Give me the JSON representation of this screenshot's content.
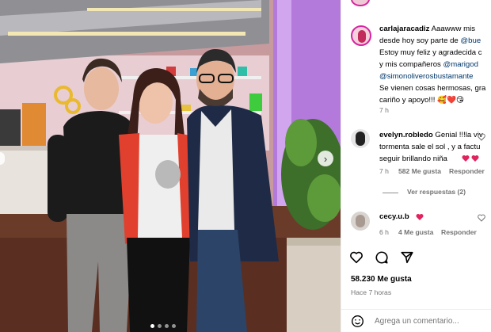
{
  "post": {
    "author": "carlajaracadiz",
    "caption_lines": [
      "Aaawww mis",
      "desde hoy soy parte de",
      "Estoy muy feliz y agradecida c",
      "y mis compañeros",
      "@simonoliverosbustamante",
      "Se vienen cosas hermosas, gra",
      "cariño y apoyo!!! 🥰❤️😘"
    ],
    "mention_1": "@bue",
    "mention_2": "@marigod",
    "caption_time": "7 h"
  },
  "comments": [
    {
      "user": "evelyn.robledo",
      "lines": [
        "Genial !!!la viv",
        "tormenta sale el sol , y a factu",
        "seguir brillando niña"
      ],
      "time": "7 h",
      "likes": "582 Me gusta",
      "reply": "Responder",
      "view_replies": "Ver respuestas (2)"
    },
    {
      "user": "cecy.u.b",
      "time": "6 h",
      "likes": "4 Me gusta",
      "reply": "Responder"
    }
  ],
  "stats": {
    "likes": "58.230 Me gusta",
    "posted": "Hace 7 horas"
  },
  "comment_box": {
    "placeholder": "Agrega un comentario..."
  },
  "icons": [
    "heart-icon",
    "comment-icon",
    "share-icon",
    "emoji-icon",
    "chevron-right-icon"
  ],
  "colors": {
    "like_red": "#ed4956",
    "link_blue": "#00376b",
    "muted": "#737373"
  }
}
